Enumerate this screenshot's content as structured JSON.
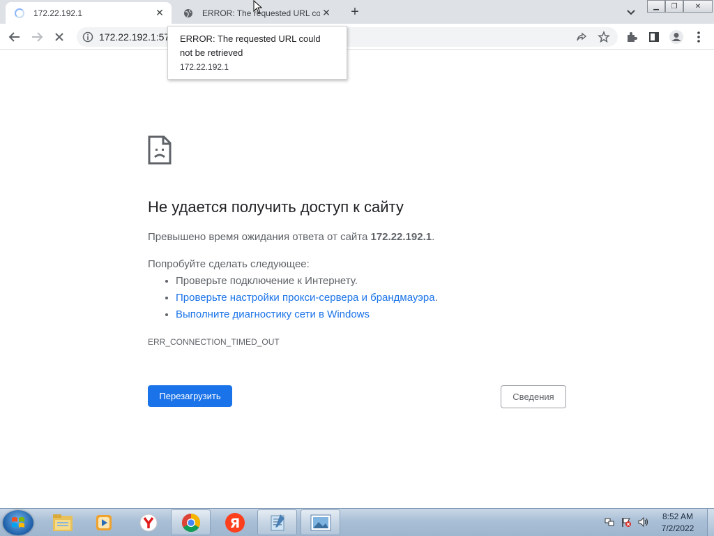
{
  "tabs": [
    {
      "title": "172.22.192.1",
      "active": true,
      "icon": "loading-spinner-icon"
    },
    {
      "title": "ERROR: The requested URL could",
      "active": false,
      "icon": "globe-icon"
    }
  ],
  "omnibox": {
    "url": "172.22.192.1:57"
  },
  "tooltip": {
    "title": "ERROR: The requested URL could not be retrieved",
    "host": "172.22.192.1"
  },
  "error_page": {
    "heading": "Не удается получить доступ к сайту",
    "desc_prefix": "Превышено время ожидания ответа от сайта ",
    "desc_host": "172.22.192.1",
    "desc_suffix": ".",
    "try_label": "Попробуйте сделать следующее:",
    "suggestions": [
      "Проверьте подключение к Интернету.",
      "Проверьте настройки прокси-сервера и брандмауэра",
      "Выполните диагностику сети в Windows"
    ],
    "suggestion_2_suffix": ".",
    "error_code": "ERR_CONNECTION_TIMED_OUT",
    "reload_label": "Перезагрузить",
    "details_label": "Сведения"
  },
  "colors": {
    "accent": "#1a73e8",
    "text_secondary": "#5f6368"
  },
  "taskbar": {
    "apps": [
      "windows-explorer-icon",
      "media-player-icon",
      "yandex-browser-icon",
      "chrome-icon",
      "yandex-icon",
      "notepad-icon",
      "photo-viewer-icon"
    ],
    "time": "8:52 AM",
    "date": "7/2/2022"
  }
}
